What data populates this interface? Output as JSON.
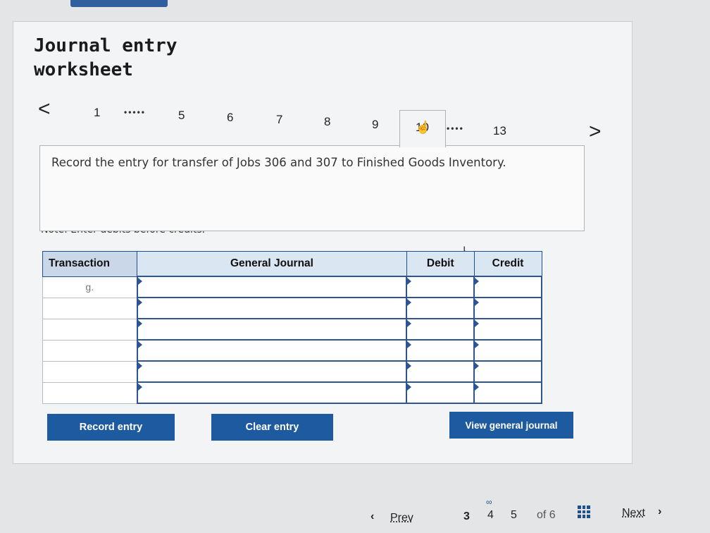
{
  "header": {
    "title_line1": "Journal entry",
    "title_line2": "worksheet"
  },
  "pager": {
    "prev_arrow": "<",
    "next_arrow": ">",
    "items": [
      "1",
      "5",
      "6",
      "7",
      "8",
      "9",
      "10",
      "13"
    ],
    "ellipsis": "•••••",
    "ellipsis2": "••••",
    "active": "10"
  },
  "question": {
    "text": "Record the entry for transfer of Jobs 306 and 307 to Finished Goods Inventory."
  },
  "note": "Note: Enter debits before credits.",
  "table": {
    "headers": {
      "transaction": "Transaction",
      "general_journal": "General Journal",
      "debit": "Debit",
      "credit": "Credit"
    },
    "rows": [
      {
        "transaction": "g.",
        "account": "",
        "debit": "",
        "credit": ""
      },
      {
        "transaction": "",
        "account": "",
        "debit": "",
        "credit": ""
      },
      {
        "transaction": "",
        "account": "",
        "debit": "",
        "credit": ""
      },
      {
        "transaction": "",
        "account": "",
        "debit": "",
        "credit": ""
      },
      {
        "transaction": "",
        "account": "",
        "debit": "",
        "credit": ""
      },
      {
        "transaction": "",
        "account": "",
        "debit": "",
        "credit": ""
      }
    ]
  },
  "buttons": {
    "record": "Record entry",
    "clear": "Clear entry",
    "view": "View general journal"
  },
  "footer": {
    "prev": "Prev",
    "pages": [
      "3",
      "4",
      "5"
    ],
    "of": "of 6",
    "next": "Next"
  },
  "colors": {
    "accent": "#1e5aa0",
    "header_bg": "#dbe6f3"
  },
  "icons": [
    "chevron-left-icon",
    "chevron-right-icon",
    "hand-pointer-icon",
    "grid-icon",
    "link-icon"
  ]
}
